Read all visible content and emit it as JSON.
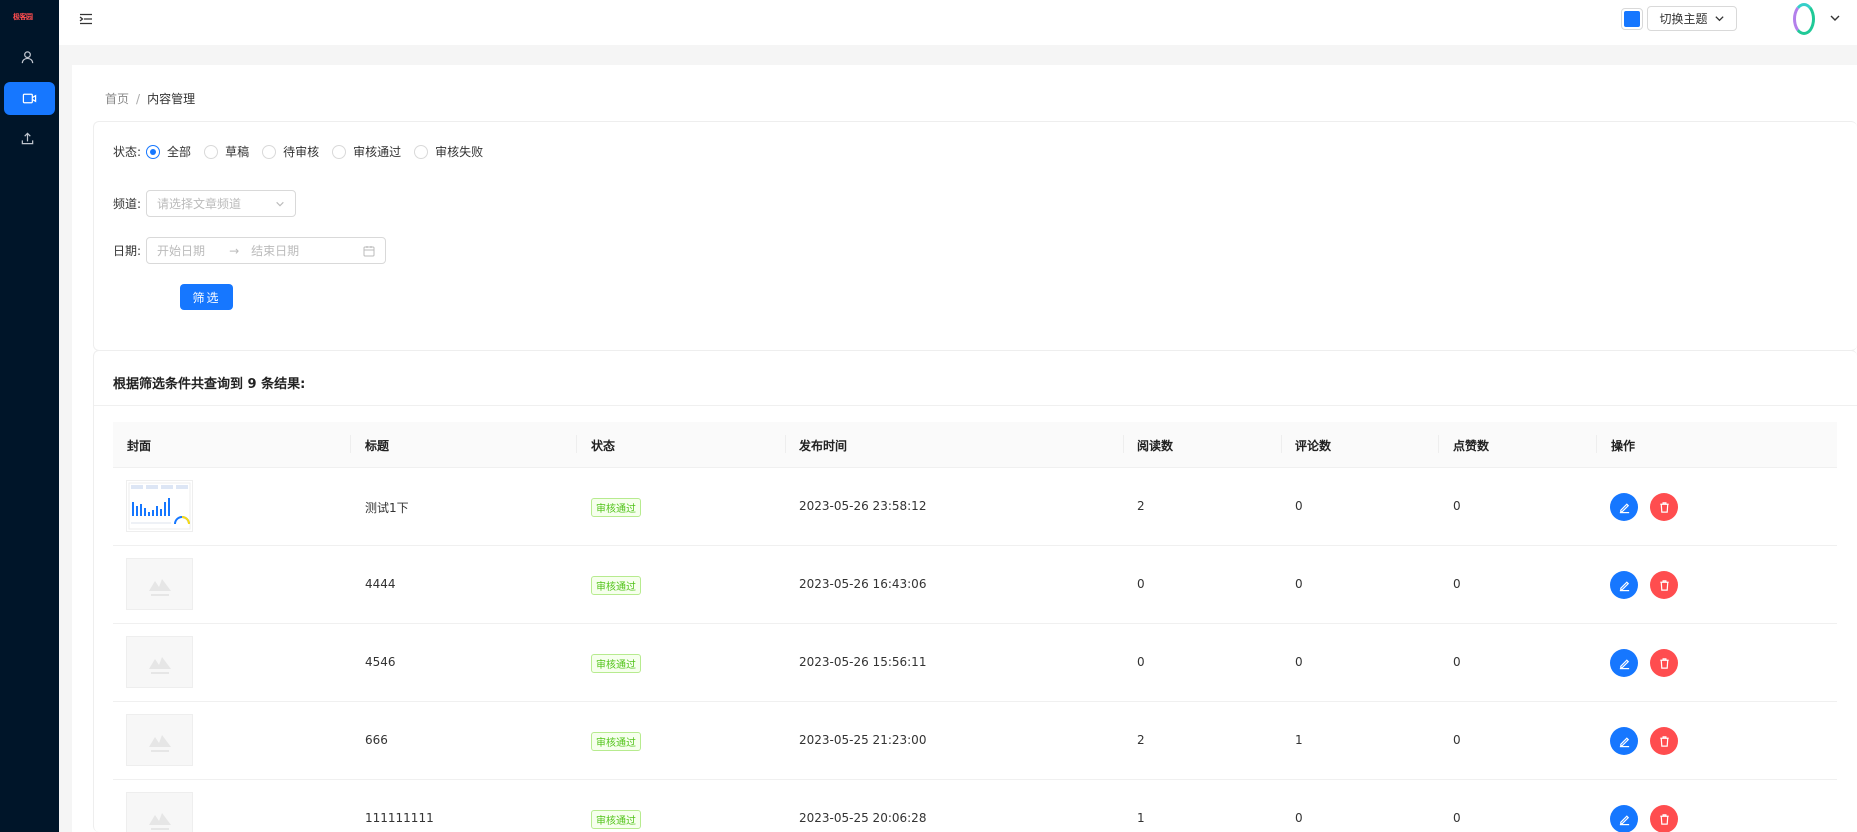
{
  "sidebar": {
    "logo": "极客园",
    "items": [
      {
        "icon": "user-icon",
        "active": false
      },
      {
        "icon": "video-icon",
        "active": true
      },
      {
        "icon": "upload-icon",
        "active": false
      }
    ]
  },
  "header": {
    "theme_button_label": "切换主题",
    "theme_color": "#1677ff"
  },
  "breadcrumb": {
    "home": "首页",
    "separator": "/",
    "current": "内容管理"
  },
  "filter": {
    "status_label": "状态:",
    "status_options": [
      "全部",
      "草稿",
      "待审核",
      "审核通过",
      "审核失败"
    ],
    "status_selected": "全部",
    "channel_label": "频道:",
    "channel_placeholder": "请选择文章频道",
    "date_label": "日期:",
    "date_start_placeholder": "开始日期",
    "date_end_placeholder": "结束日期",
    "date_arrow": "→",
    "submit_label": "筛选"
  },
  "results": {
    "title": "根据筛选条件共查询到 9 条结果:",
    "columns": [
      "封面",
      "标题",
      "状态",
      "发布时间",
      "阅读数",
      "评论数",
      "点赞数",
      "操作"
    ],
    "rows": [
      {
        "title": "测试1下",
        "status": "审核通过",
        "pubdate": "2023-05-26 23:58:12",
        "read": "2",
        "comment": "0",
        "like": "0",
        "cover": "chart-thumbnail"
      },
      {
        "title": "4444",
        "status": "审核通过",
        "pubdate": "2023-05-26 16:43:06",
        "read": "0",
        "comment": "0",
        "like": "0",
        "cover": "placeholder"
      },
      {
        "title": "4546",
        "status": "审核通过",
        "pubdate": "2023-05-26 15:56:11",
        "read": "0",
        "comment": "0",
        "like": "0",
        "cover": "placeholder"
      },
      {
        "title": "666",
        "status": "审核通过",
        "pubdate": "2023-05-25 21:23:00",
        "read": "2",
        "comment": "1",
        "like": "0",
        "cover": "placeholder"
      },
      {
        "title": "111111111",
        "status": "审核通过",
        "pubdate": "2023-05-25 20:06:28",
        "read": "1",
        "comment": "0",
        "like": "0",
        "cover": "placeholder"
      }
    ]
  }
}
